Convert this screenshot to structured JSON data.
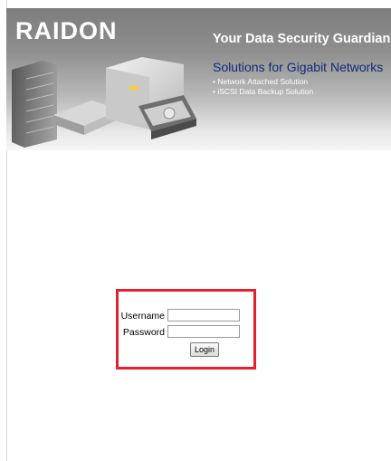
{
  "banner": {
    "logo": "RAIDON",
    "tagline": "Your Data Security Guardian.",
    "subtitle": "Solutions for Gigabit Networks",
    "bullets": [
      "• Network Attached Solution",
      "• iSCSI Data Backup Solution"
    ]
  },
  "login": {
    "username_label": "Username",
    "username_value": "",
    "password_label": "Password",
    "password_value": "",
    "button_label": "Login"
  },
  "colors": {
    "highlight_border": "#e0222e",
    "subtitle_text": "#102a78"
  },
  "icons": {
    "hardware_illustration": "storage-devices-illustration"
  }
}
